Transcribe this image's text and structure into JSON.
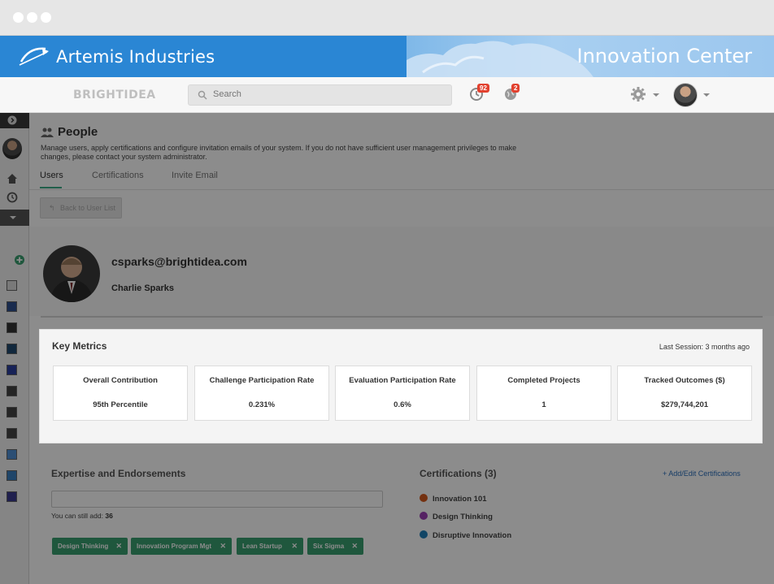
{
  "banner": {
    "brand": "Artemis Industries",
    "section_title": "Innovation Center"
  },
  "topbar": {
    "product_logo": "BRIGHTIDEA",
    "search_placeholder": "Search",
    "notifications": [
      {
        "icon": "clock-icon",
        "count": "92"
      },
      {
        "icon": "globe-icon",
        "count": "2"
      }
    ]
  },
  "page": {
    "title": "People",
    "description": "Manage users, apply certifications and configure invitation emails of your system. If you do not have sufficient user management privileges to make changes, please contact your system administrator.",
    "tabs": [
      "Users",
      "Certifications",
      "Invite Email"
    ],
    "back_button": "Back to User List"
  },
  "profile": {
    "email": "csparks@brightidea.com",
    "name": "Charlie Sparks"
  },
  "key_metrics": {
    "title": "Key Metrics",
    "last_session": "Last Session: 3 months ago",
    "cards": [
      {
        "label": "Overall Contribution",
        "value": "95th Percentile"
      },
      {
        "label": "Challenge Participation Rate",
        "value": "0.231%"
      },
      {
        "label": "Evaluation Participation Rate",
        "value": "0.6%"
      },
      {
        "label": "Completed Projects",
        "value": "1"
      },
      {
        "label": "Tracked Outcomes ($)",
        "value": "$279,744,201"
      }
    ]
  },
  "expertise": {
    "title": "Expertise and Endorsements",
    "can_add_label": "You can still add:",
    "can_add_count": "36",
    "tags": [
      "Design Thinking",
      "Innovation Program Mgt",
      "Lean Startup",
      "Six Sigma"
    ]
  },
  "certifications": {
    "title": "Certifications (3)",
    "add_link": "+ Add/Edit Certifications",
    "items": [
      {
        "label": "Innovation 101",
        "color": "#d45a1e"
      },
      {
        "label": "Design Thinking",
        "color": "#9b3fb5"
      },
      {
        "label": "Disruptive Innovation",
        "color": "#1f7fb8"
      }
    ]
  }
}
